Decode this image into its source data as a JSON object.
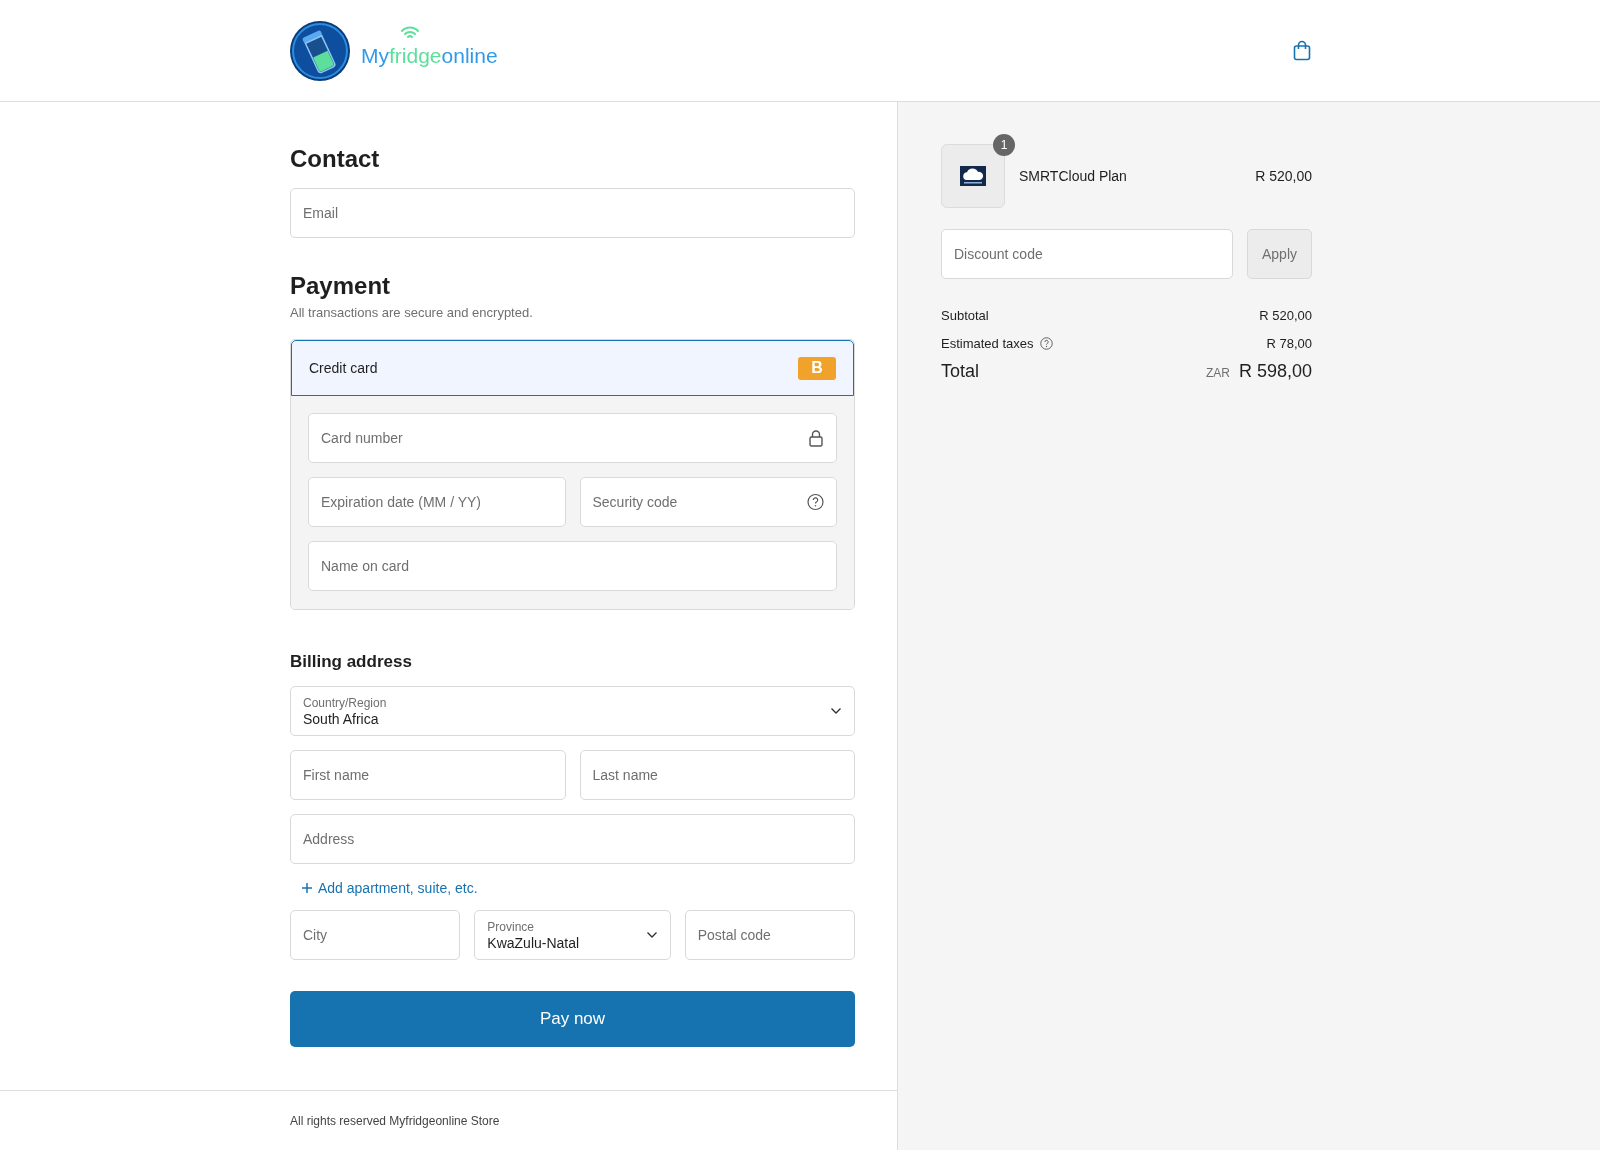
{
  "header": {
    "logo": {
      "parts": [
        {
          "text": "My",
          "color": "#2f9be8"
        },
        {
          "text": "fridge",
          "color": "#5ddf9c"
        },
        {
          "text": "online",
          "color": "#2f9be8"
        }
      ]
    }
  },
  "contact": {
    "heading": "Contact",
    "fields": [
      {
        "kind": "text",
        "placeholder": "Email"
      }
    ]
  },
  "payment": {
    "heading": "Payment",
    "subtitle": "All transactions are secure and encrypted.",
    "methods": [
      {
        "label": "Credit card",
        "badge": "B",
        "selected": true
      }
    ],
    "rows": [
      [
        {
          "kind": "lock",
          "placeholder": "Card number"
        }
      ],
      [
        {
          "kind": "text",
          "placeholder": "Expiration date (MM / YY)"
        },
        {
          "kind": "help",
          "placeholder": "Security code"
        }
      ],
      [
        {
          "kind": "text",
          "placeholder": "Name on card"
        }
      ]
    ]
  },
  "billing": {
    "heading": "Billing address",
    "rows": [
      [
        {
          "kind": "select",
          "label": "Country/Region",
          "value": "South Africa"
        }
      ],
      [
        {
          "kind": "text",
          "placeholder": "First name"
        },
        {
          "kind": "text",
          "placeholder": "Last name"
        }
      ],
      [
        {
          "kind": "text",
          "placeholder": "Address"
        }
      ]
    ],
    "link": "Add apartment, suite, etc.",
    "rows_after": [
      [
        {
          "kind": "text",
          "placeholder": "City"
        },
        {
          "kind": "select",
          "label": "Province",
          "value": "KwaZulu-Natal"
        },
        {
          "kind": "text",
          "placeholder": "Postal code"
        }
      ]
    ]
  },
  "pay_button": "Pay now",
  "footer": "All rights reserved Myfridgeonline Store",
  "summary": {
    "items": [
      {
        "name": "SMRTCloud Plan",
        "price": "R 520,00",
        "quantity": "1"
      }
    ],
    "discount": {
      "placeholder": "Discount code",
      "button": "Apply"
    },
    "lines": [
      {
        "kind": "plain",
        "label": "Subtotal",
        "value": "R 520,00"
      },
      {
        "kind": "help",
        "label": "Estimated taxes",
        "value": "R 78,00"
      }
    ],
    "total": {
      "label": "Total",
      "currency": "ZAR",
      "value": "R 598,00"
    }
  }
}
